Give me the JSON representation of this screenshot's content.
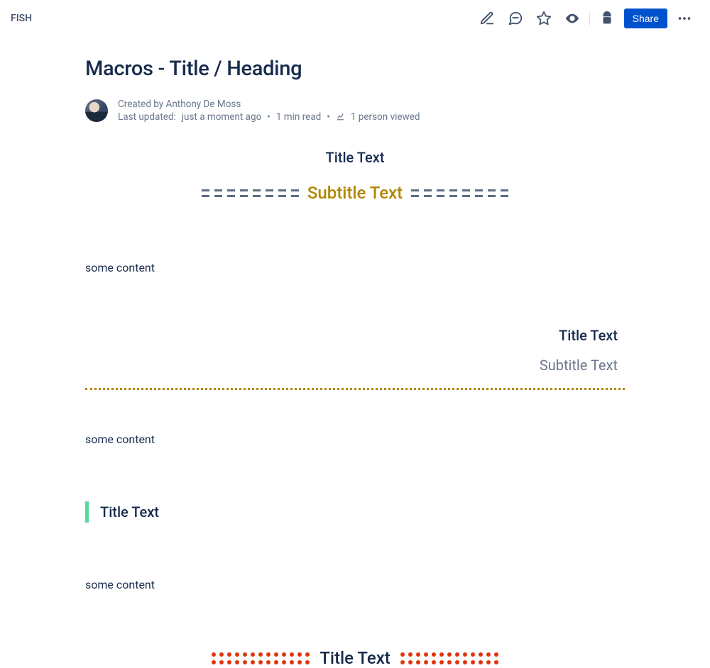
{
  "breadcrumb": "FISH",
  "toolbar": {
    "share_label": "Share"
  },
  "page": {
    "title": "Macros - Title / Heading",
    "created_by_prefix": "Created by ",
    "author": "Anthony De Moss",
    "last_updated_prefix": "Last updated: ",
    "last_updated": "just a moment ago",
    "read_time": "1 min read",
    "viewers": "1 person viewed"
  },
  "macros": {
    "m1": {
      "title": "Title Text",
      "subtitle": "Subtitle Text"
    },
    "m2": {
      "title": "Title Text",
      "subtitle": "Subtitle Text"
    },
    "m3": {
      "title": "Title Text"
    },
    "m4": {
      "title": "Title Text"
    }
  },
  "body": {
    "p1": "some content",
    "p2": "some content",
    "p3": "some content"
  }
}
